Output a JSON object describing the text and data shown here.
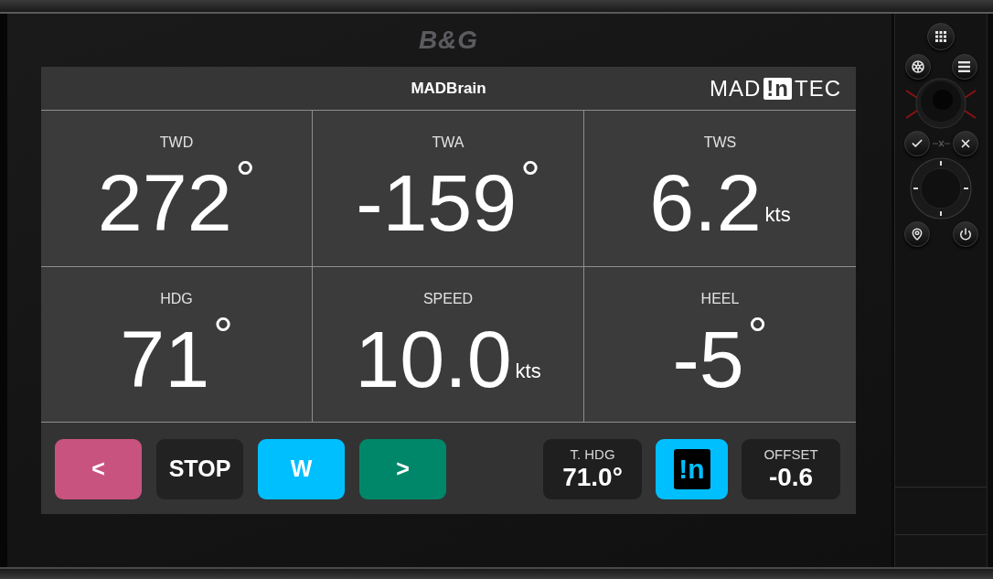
{
  "device": {
    "brand": "B&G"
  },
  "app": {
    "title": "MADBrain",
    "logo": {
      "before": "MAD",
      "mark": "!n",
      "after": "TEC"
    }
  },
  "tiles": [
    {
      "kind": "angle",
      "label": "TWD",
      "value": "272",
      "unit": "°"
    },
    {
      "kind": "angle",
      "label": "TWA",
      "value": "-159",
      "unit": "°"
    },
    {
      "kind": "speed",
      "label": "TWS",
      "value": "6.2",
      "unit": "kts"
    },
    {
      "kind": "angle",
      "label": "HDG",
      "value": "71",
      "unit": "°"
    },
    {
      "kind": "speed",
      "label": "SPEED",
      "value": "10.0",
      "unit": "kts"
    },
    {
      "kind": "angle",
      "label": "HEEL",
      "value": "-5",
      "unit": "°"
    }
  ],
  "controls": [
    {
      "kind": "button",
      "label": "<",
      "color": "#c9537f"
    },
    {
      "kind": "button",
      "label": "STOP",
      "color": "#222222"
    },
    {
      "kind": "button",
      "label": "W",
      "color": "#00bfff"
    },
    {
      "kind": "button",
      "label": ">",
      "color": "#00876a"
    },
    {
      "kind": "readout",
      "label": "T. HDG",
      "value": "71.0°"
    },
    {
      "kind": "logo_button",
      "label": "!n",
      "color": "#00bfff"
    },
    {
      "kind": "readout",
      "label": "OFFSET",
      "value": "-0.6"
    }
  ]
}
